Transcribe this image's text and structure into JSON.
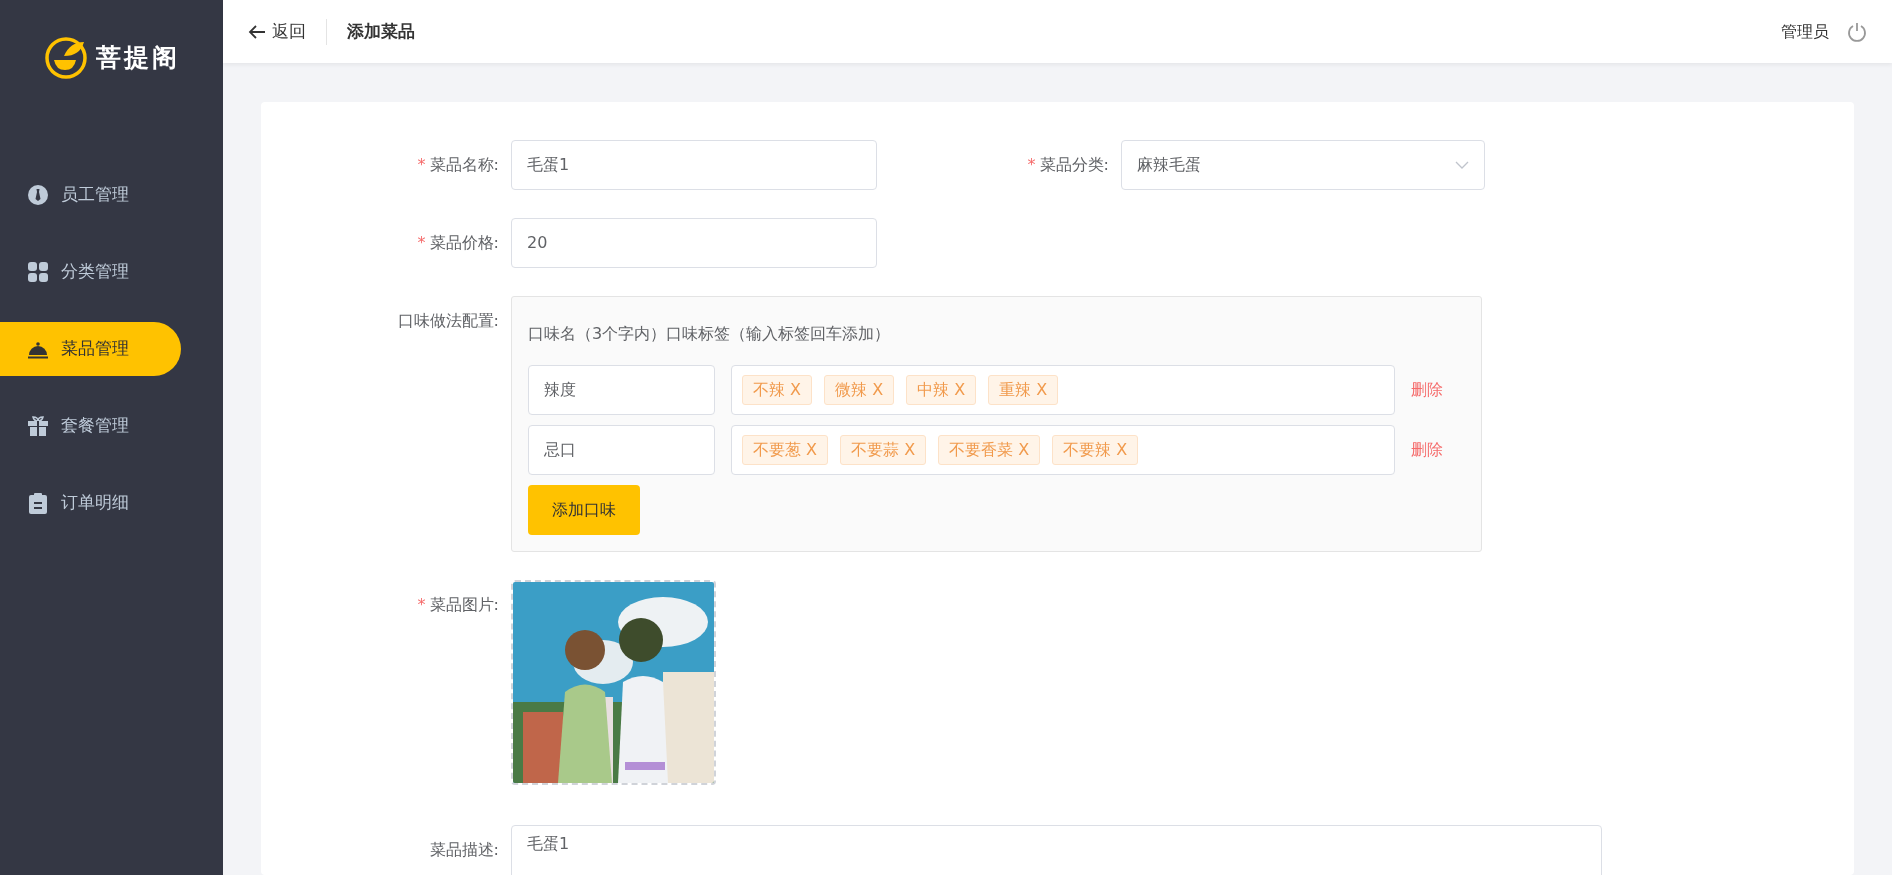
{
  "sidebar": {
    "logo": "菩提阁",
    "items": [
      {
        "label": "员工管理",
        "kind": "employee",
        "selected": false
      },
      {
        "label": "分类管理",
        "kind": "category",
        "selected": false
      },
      {
        "label": "菜品管理",
        "kind": "dish",
        "selected": true
      },
      {
        "label": "套餐管理",
        "kind": "gift",
        "selected": false
      },
      {
        "label": "订单明细",
        "kind": "order",
        "selected": false
      }
    ]
  },
  "header": {
    "back": "返回",
    "title": "添加菜品",
    "user": "管理员"
  },
  "form": {
    "name": {
      "mark": "*",
      "label": "菜品名称:",
      "value": "毛蛋1"
    },
    "category": {
      "mark": "*",
      "label": "菜品分类:",
      "value": "麻辣毛蛋"
    },
    "price": {
      "mark": "*",
      "label": "菜品价格:",
      "value": "20"
    },
    "flavors": {
      "label": "口味做法配置:",
      "heading": "口味名（3个字内）口味标签（输入标签回车添加）",
      "add_button": "添加口味",
      "rows": [
        {
          "name": "辣度",
          "tags": [
            "不辣 X",
            "微辣 X",
            "中辣 X",
            "重辣 X"
          ],
          "delete": "删除"
        },
        {
          "name": "忌口",
          "tags": [
            "不要葱 X",
            "不要蒜 X",
            "不要香菜 X",
            "不要辣 X"
          ],
          "delete": "删除"
        }
      ]
    },
    "image": {
      "mark": "*",
      "label": "菜品图片:",
      "kind": "picture"
    },
    "description": {
      "label": "菜品描述:",
      "value": "毛蛋1"
    }
  }
}
